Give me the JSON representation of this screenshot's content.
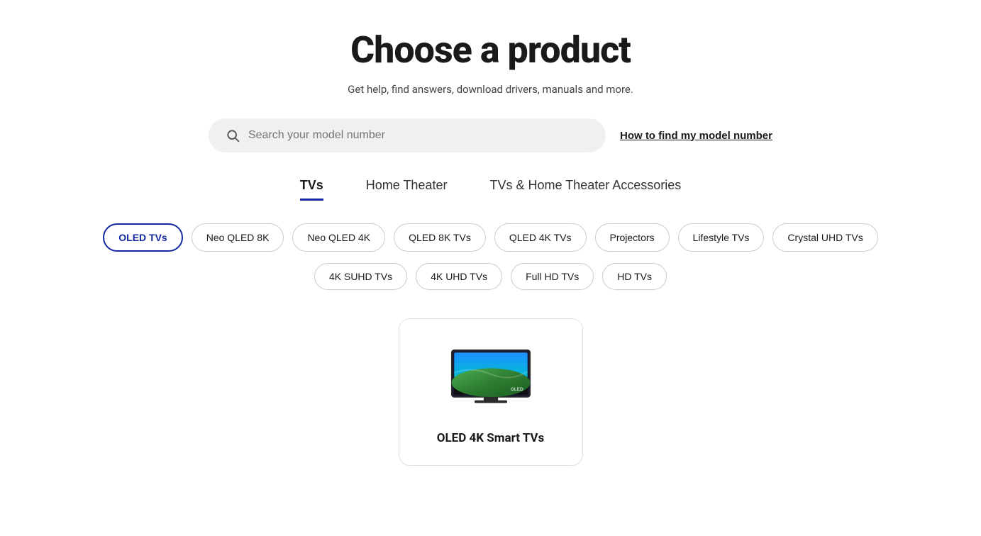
{
  "page": {
    "title": "Choose a product",
    "subtitle": "Get help, find answers, download drivers, manuals and more."
  },
  "search": {
    "placeholder": "Search your model number",
    "model_link": "How to find my model number"
  },
  "tabs": [
    {
      "id": "tvs",
      "label": "TVs",
      "active": true
    },
    {
      "id": "home-theater",
      "label": "Home Theater",
      "active": false
    },
    {
      "id": "accessories",
      "label": "TVs & Home Theater Accessories",
      "active": false
    }
  ],
  "chips_row1": [
    {
      "id": "oled-tvs",
      "label": "OLED TVs",
      "selected": true
    },
    {
      "id": "neo-qled-8k",
      "label": "Neo QLED 8K",
      "selected": false
    },
    {
      "id": "neo-qled-4k",
      "label": "Neo QLED 4K",
      "selected": false
    },
    {
      "id": "qled-8k-tvs",
      "label": "QLED 8K TVs",
      "selected": false
    },
    {
      "id": "qled-4k-tvs",
      "label": "QLED 4K TVs",
      "selected": false
    },
    {
      "id": "projectors",
      "label": "Projectors",
      "selected": false
    },
    {
      "id": "lifestyle-tvs",
      "label": "Lifestyle TVs",
      "selected": false
    },
    {
      "id": "crystal-uhd-tvs",
      "label": "Crystal UHD TVs",
      "selected": false
    }
  ],
  "chips_row2": [
    {
      "id": "4k-suhd-tvs",
      "label": "4K SUHD TVs",
      "selected": false
    },
    {
      "id": "4k-uhd-tvs",
      "label": "4K UHD TVs",
      "selected": false
    },
    {
      "id": "full-hd-tvs",
      "label": "Full HD TVs",
      "selected": false
    },
    {
      "id": "hd-tvs",
      "label": "HD TVs",
      "selected": false
    }
  ],
  "product_card": {
    "label": "OLED 4K Smart TVs"
  }
}
